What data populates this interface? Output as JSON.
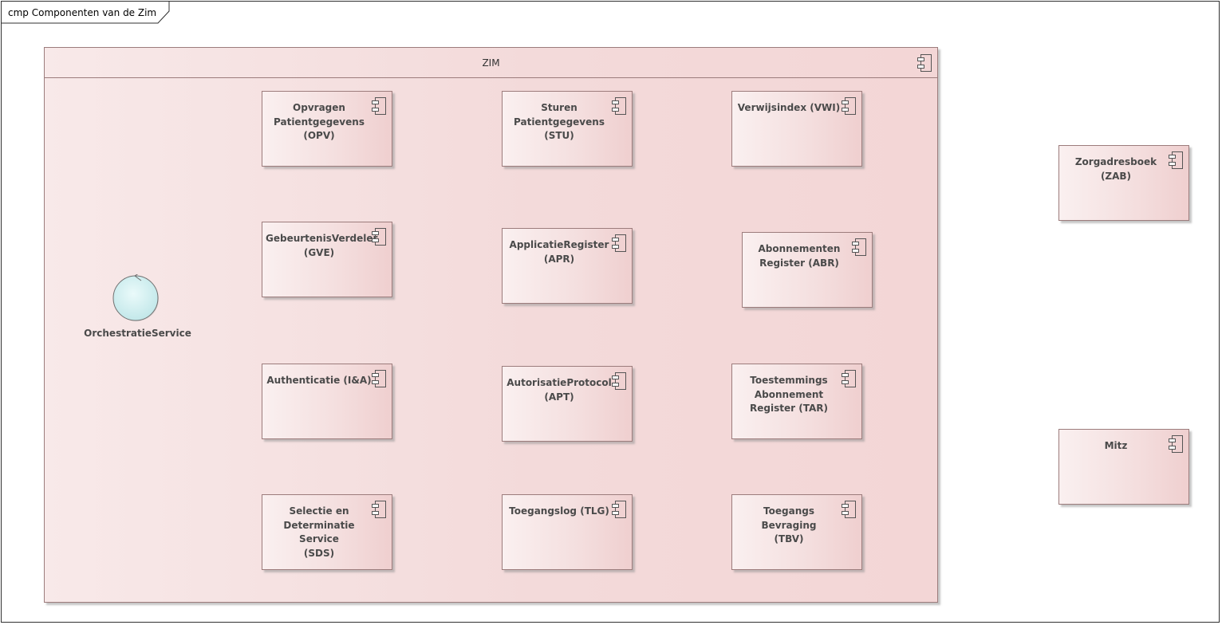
{
  "diagram": {
    "frame_title": "cmp Componenten van de Zim",
    "container": {
      "title": "ZIM"
    },
    "orchestration": {
      "label": "OrchestratieService"
    },
    "components": [
      {
        "id": "opv",
        "label": "Opvragen\nPatientgegevens\n(OPV)"
      },
      {
        "id": "stu",
        "label": "Sturen\nPatientgegevens\n(STU)"
      },
      {
        "id": "vwi",
        "label": "Verwijsindex (VWI)"
      },
      {
        "id": "gve",
        "label": "GebeurtenisVerdeler\n(GVE)"
      },
      {
        "id": "apr",
        "label": "ApplicatieRegister\n(APR)"
      },
      {
        "id": "abr",
        "label": "Abonnementen\nRegister (ABR)"
      },
      {
        "id": "ia",
        "label": "Authenticatie (I&A)"
      },
      {
        "id": "apt",
        "label": "AutorisatieProtocol\n(APT)"
      },
      {
        "id": "tar",
        "label": "Toestemmings\nAbonnement\nRegister (TAR)"
      },
      {
        "id": "sds",
        "label": "Selectie en\nDeterminatie Service\n(SDS)"
      },
      {
        "id": "tlg",
        "label": "Toegangslog (TLG)"
      },
      {
        "id": "tbv",
        "label": "Toegangs Bevraging\n(TBV)"
      }
    ],
    "external_components": [
      {
        "id": "zab",
        "label": "Zorgadresboek (ZAB)"
      },
      {
        "id": "mitz",
        "label": "Mitz"
      }
    ],
    "colors": {
      "component_fill": "#f4dede",
      "component_border": "#9c7c7c",
      "orchestration_fill": "#d2f0f0"
    }
  }
}
